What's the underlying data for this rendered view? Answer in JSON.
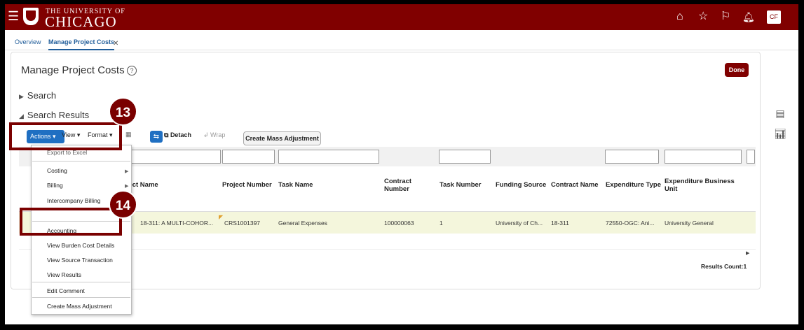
{
  "header": {
    "university_line1": "THE UNIVERSITY OF",
    "university_line2": "CHICAGO",
    "avatar_initials": "CF",
    "brand_color": "#800000"
  },
  "tabs": [
    {
      "label": "Overview"
    },
    {
      "label": "Manage Project Costs"
    }
  ],
  "page": {
    "title": "Manage Project Costs",
    "done_label": "Done",
    "search_label": "Search",
    "results_label": "Search Results"
  },
  "toolbar": {
    "actions_label": "Actions",
    "view_label": "View",
    "format_label": "Format",
    "detach_label": "Detach",
    "wrap_label": "Wrap",
    "mass_label": "Create Mass Adjustment"
  },
  "menu": {
    "items": [
      "Export to Excel",
      "Costing",
      "Billing",
      "Intercompany Billing",
      "Accounting",
      "View Burden Cost Details",
      "View Source Transaction",
      "View Results",
      "Edit Comment",
      "Create Mass Adjustment"
    ]
  },
  "table": {
    "columns": [
      "oject Name",
      "Project Number",
      "Task Name",
      "Contract Number",
      "Task Number",
      "Funding Source",
      "Contract Name",
      "Expenditure Type",
      "Expenditure Business Unit"
    ],
    "row": {
      "project_name": "18-311: A MULTI-COHOR...",
      "project_number": "CRS1001397",
      "task_name": "General Expenses",
      "contract_number": "100000063",
      "task_number": "1",
      "funding_source": "University of Ch...",
      "contract_name": "18-311",
      "expenditure_type": "72550-OGC: Ani...",
      "expenditure_bu": "University General"
    },
    "results_count": "Results Count:1"
  },
  "annotations": {
    "step13": "13",
    "step14": "14"
  }
}
